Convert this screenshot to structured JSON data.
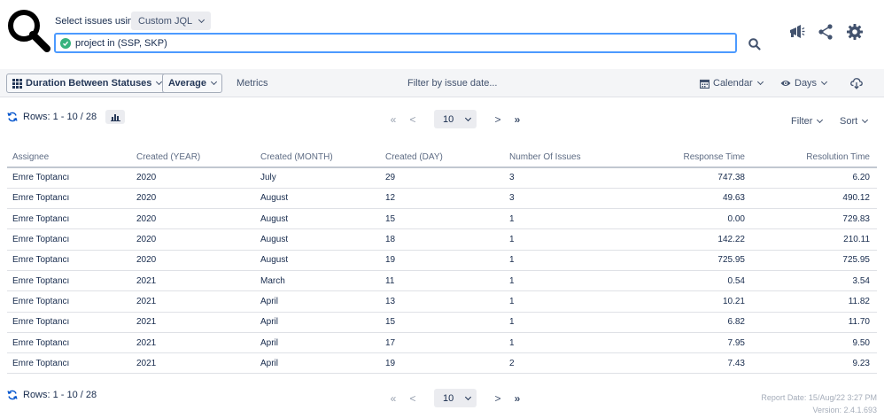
{
  "header": {
    "select_label": "Select issues using",
    "jql_mode": "Custom JQL",
    "jql_query": "project in (SSP, SKP)"
  },
  "toolbar": {
    "report_type": "Duration Between Statuses",
    "aggregation": "Average",
    "metrics": "Metrics",
    "date_filter": "Filter by issue date...",
    "calendar": "Calendar",
    "time_unit": "Days"
  },
  "pagination": {
    "rows_label": "Rows: 1 - 10 / 28",
    "page_size": "10",
    "first": "«",
    "prev": "<",
    "next": ">",
    "last": "»"
  },
  "controls": {
    "filter": "Filter",
    "sort": "Sort"
  },
  "table": {
    "columns": [
      "Assignee",
      "Created (YEAR)",
      "Created (MONTH)",
      "Created (DAY)",
      "Number Of Issues",
      "Response Time",
      "Resolution Time"
    ],
    "rows": [
      [
        "Emre Toptancı",
        "2020",
        "July",
        "29",
        "3",
        "747.38",
        "6.20"
      ],
      [
        "Emre Toptancı",
        "2020",
        "August",
        "12",
        "3",
        "49.63",
        "490.12"
      ],
      [
        "Emre Toptancı",
        "2020",
        "August",
        "15",
        "1",
        "0.00",
        "729.83"
      ],
      [
        "Emre Toptancı",
        "2020",
        "August",
        "18",
        "1",
        "142.22",
        "210.11"
      ],
      [
        "Emre Toptancı",
        "2020",
        "August",
        "19",
        "1",
        "725.95",
        "725.95"
      ],
      [
        "Emre Toptancı",
        "2021",
        "March",
        "11",
        "1",
        "0.54",
        "3.54"
      ],
      [
        "Emre Toptancı",
        "2021",
        "April",
        "13",
        "1",
        "10.21",
        "11.82"
      ],
      [
        "Emre Toptancı",
        "2021",
        "April",
        "15",
        "1",
        "6.82",
        "11.70"
      ],
      [
        "Emre Toptancı",
        "2021",
        "April",
        "17",
        "1",
        "7.95",
        "9.50"
      ],
      [
        "Emre Toptancı",
        "2021",
        "April",
        "19",
        "2",
        "7.43",
        "9.23"
      ]
    ]
  },
  "footer": {
    "report_date": "Report Date: 15/Aug/22 3:27 PM",
    "version": "Version: 2.4.1.693"
  },
  "colors": {
    "accent": "#4c9aff",
    "success": "#36b37e",
    "text": "#172b4d",
    "muted": "#5e6c84"
  }
}
